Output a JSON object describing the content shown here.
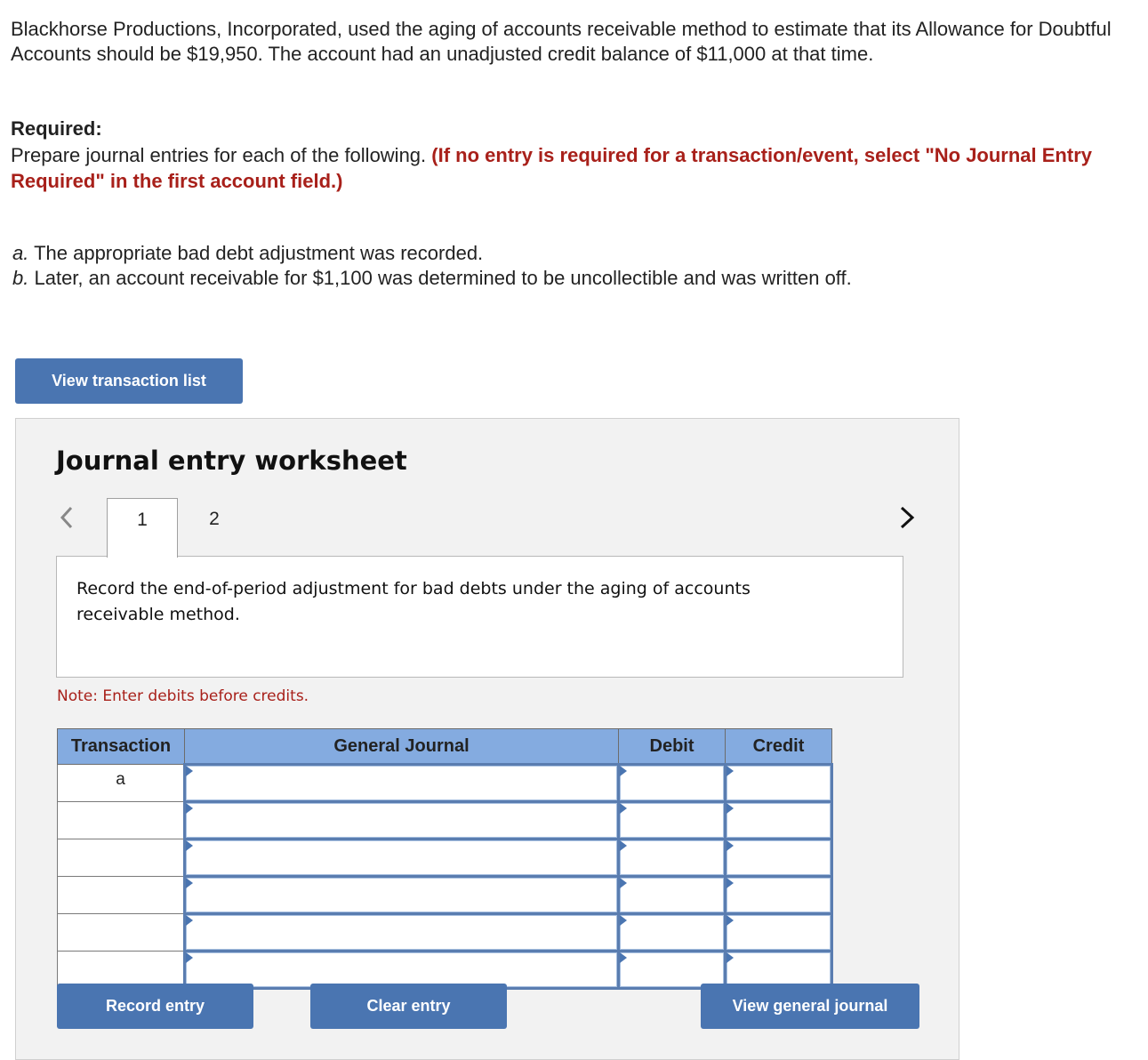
{
  "problem": {
    "intro": "Blackhorse Productions, Incorporated, used the aging of accounts receivable method to estimate that its Allowance for Doubtful Accounts should be $19,950. The account had an unadjusted credit balance of $11,000 at that time.",
    "required_label": "Required:",
    "required_text": "Prepare journal entries for each of the following.",
    "required_instruction": "(If no entry is required for a transaction/event, select \"No Journal Entry Required\" in the first account field.)",
    "items": [
      {
        "letter": "a.",
        "text": "The appropriate bad debt adjustment was recorded."
      },
      {
        "letter": "b.",
        "text": "Later, an account receivable for $1,100 was determined to be uncollectible and was written off."
      }
    ]
  },
  "buttons": {
    "view_transaction_list": "View transaction list",
    "record_entry": "Record entry",
    "clear_entry": "Clear entry",
    "view_general_journal": "View general journal"
  },
  "worksheet": {
    "title": "Journal entry worksheet",
    "tabs": [
      {
        "label": "1",
        "active": true
      },
      {
        "label": "2",
        "active": false
      }
    ],
    "description": "Record the end-of-period adjustment for bad debts under the aging of accounts receivable method.",
    "note": "Note: Enter debits before credits.",
    "table": {
      "headers": [
        "Transaction",
        "General Journal",
        "Debit",
        "Credit"
      ],
      "rows": [
        {
          "transaction": "a",
          "account": "",
          "debit": "",
          "credit": ""
        },
        {
          "transaction": "",
          "account": "",
          "debit": "",
          "credit": ""
        },
        {
          "transaction": "",
          "account": "",
          "debit": "",
          "credit": ""
        },
        {
          "transaction": "",
          "account": "",
          "debit": "",
          "credit": ""
        },
        {
          "transaction": "",
          "account": "",
          "debit": "",
          "credit": ""
        },
        {
          "transaction": "",
          "account": "",
          "debit": "",
          "credit": ""
        }
      ]
    }
  },
  "colors": {
    "accent_button": "#4a75b1",
    "table_header": "#84abe0",
    "instruction_red": "#a8201a"
  }
}
